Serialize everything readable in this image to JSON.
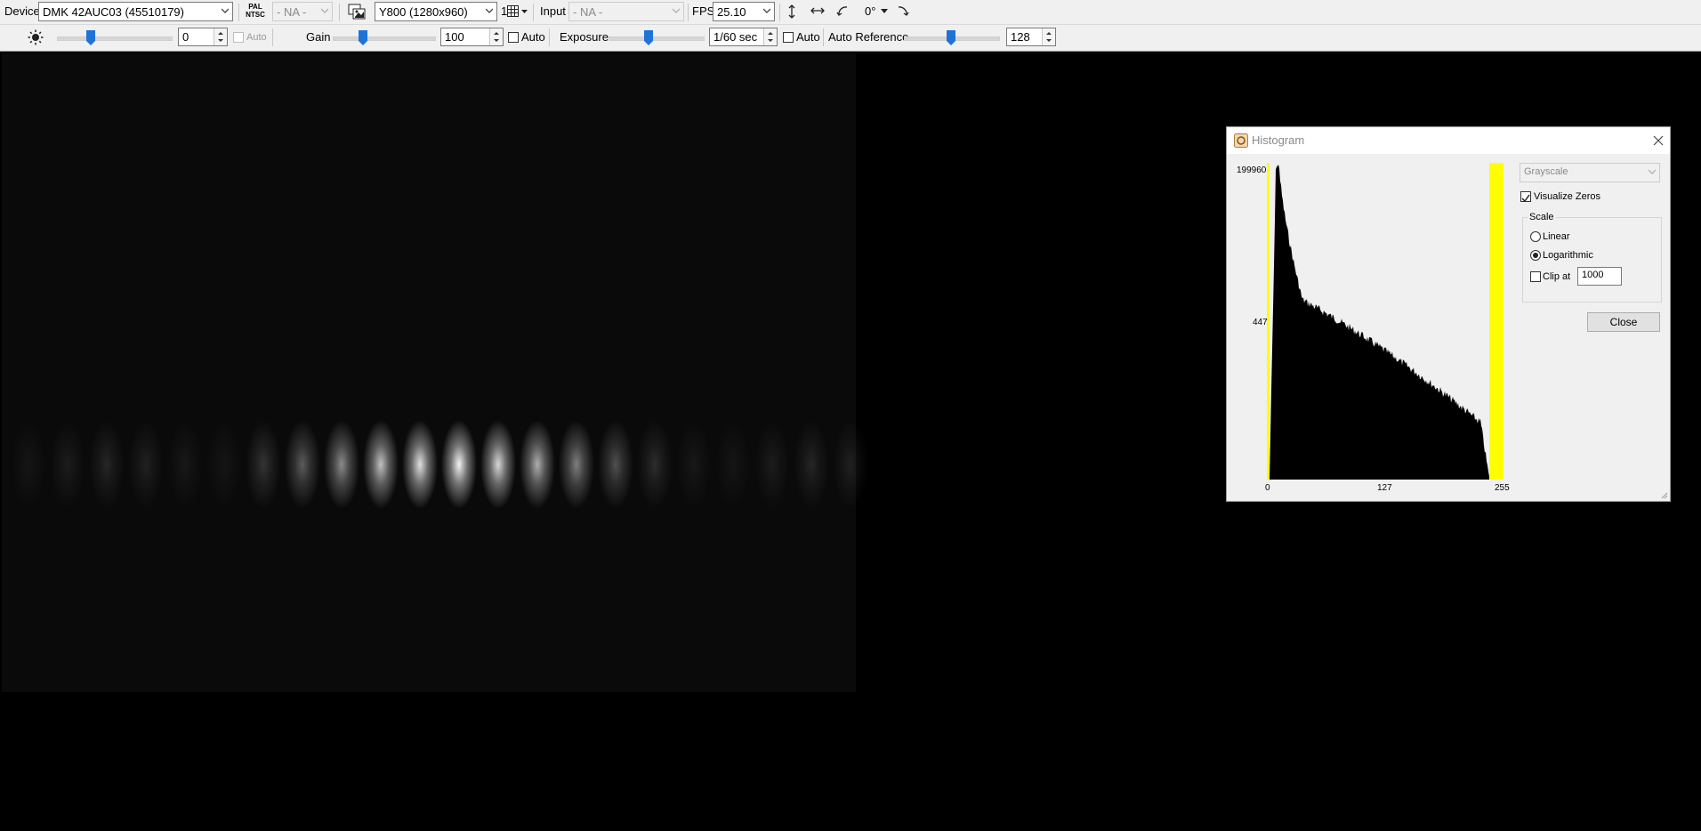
{
  "toolbar1": {
    "device_label": "Device",
    "device_value": "DMK 42AUC03 (45510179)",
    "video_norm_icon_top": "PAL",
    "video_norm_icon_bottom": "NTSC",
    "video_norm_value": "- NA -",
    "format_value": "Y800 (1280x960)",
    "binning_value": "1",
    "input_label": "Input",
    "input_value": "- NA -",
    "fps_label": "FPS",
    "fps_value": "25.10",
    "rotation_value": "0°"
  },
  "toolbar2": {
    "brightness_value": "0",
    "brightness_auto_label": "Auto",
    "gain_label": "Gain",
    "gain_value": "100",
    "gain_auto_label": "Auto",
    "exposure_label": "Exposure",
    "exposure_value": "1/60 sec",
    "exposure_auto_label": "Auto",
    "auto_reference_label": "Auto Reference",
    "auto_reference_value": "128",
    "brightness_slider": 0.28,
    "gain_slider": 0.28,
    "exposure_slider": 0.42,
    "auto_reference_slider": 0.5
  },
  "histogram": {
    "title": "Histogram",
    "y_max_label": "199960",
    "y_mid_label": "447",
    "x_labels": [
      "0",
      "127",
      "255"
    ],
    "channel_value": "Grayscale",
    "visualize_zeros_label": "Visualize Zeros",
    "visualize_zeros_checked": true,
    "scale_group_label": "Scale",
    "scale_options": [
      "Linear",
      "Logarithmic"
    ],
    "scale_selected": "Logarithmic",
    "clip_label": "Clip at",
    "clip_value": "1000",
    "clip_checked": false,
    "close_label": "Close",
    "marker_color": "#ffff00"
  },
  "fringes": {
    "peak_color": "#ffffff",
    "intensities": [
      0.05,
      0.08,
      0.12,
      0.1,
      0.06,
      0.05,
      0.18,
      0.35,
      0.55,
      0.78,
      0.92,
      1.0,
      0.88,
      0.7,
      0.5,
      0.3,
      0.15,
      0.06,
      0.05,
      0.08,
      0.12,
      0.1
    ]
  },
  "colors": {
    "toolbar_bg": "#f0f0f0",
    "slider_thumb": "#1e74d6",
    "viewport_bg": "#0a0a0a",
    "background": "#000000"
  }
}
